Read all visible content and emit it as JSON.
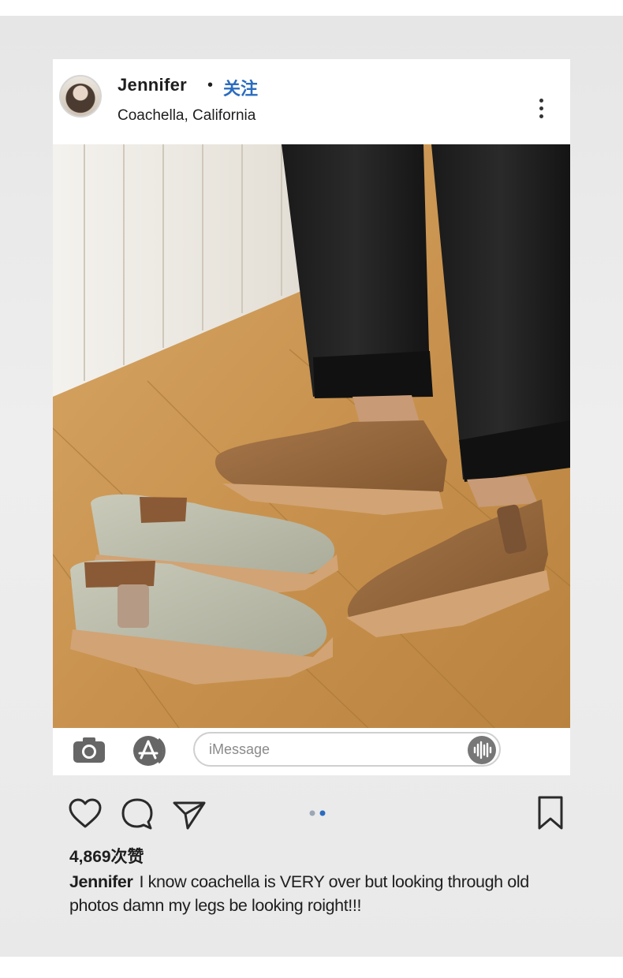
{
  "post": {
    "username": "Jennifer",
    "separator": "•",
    "follow_label": "关注",
    "location": "Coachella, California",
    "likes": "4,869次赞",
    "caption_user": "Jennifer",
    "caption_text": "I know coachella is VERY over but looking through old photos damn my legs be looking roight!!!"
  },
  "message_bar": {
    "placeholder": "iMessage"
  },
  "icons": {
    "avatar": "profile-photo",
    "more": "more-vertical-icon",
    "camera": "camera-icon",
    "app_store": "app-store-icon",
    "audio": "audio-waveform-icon",
    "like": "heart-icon",
    "comment": "comment-icon",
    "share": "paper-plane-icon",
    "bookmark": "bookmark-icon"
  },
  "carousel": {
    "pages": 2,
    "current": 2
  },
  "colors": {
    "follow": "#2a6cc0",
    "active_dot": "#2a6cc0",
    "inactive_dot": "#9aa7b5",
    "frame_bg": "#e9e9e9",
    "text": "#1e1e1e"
  }
}
